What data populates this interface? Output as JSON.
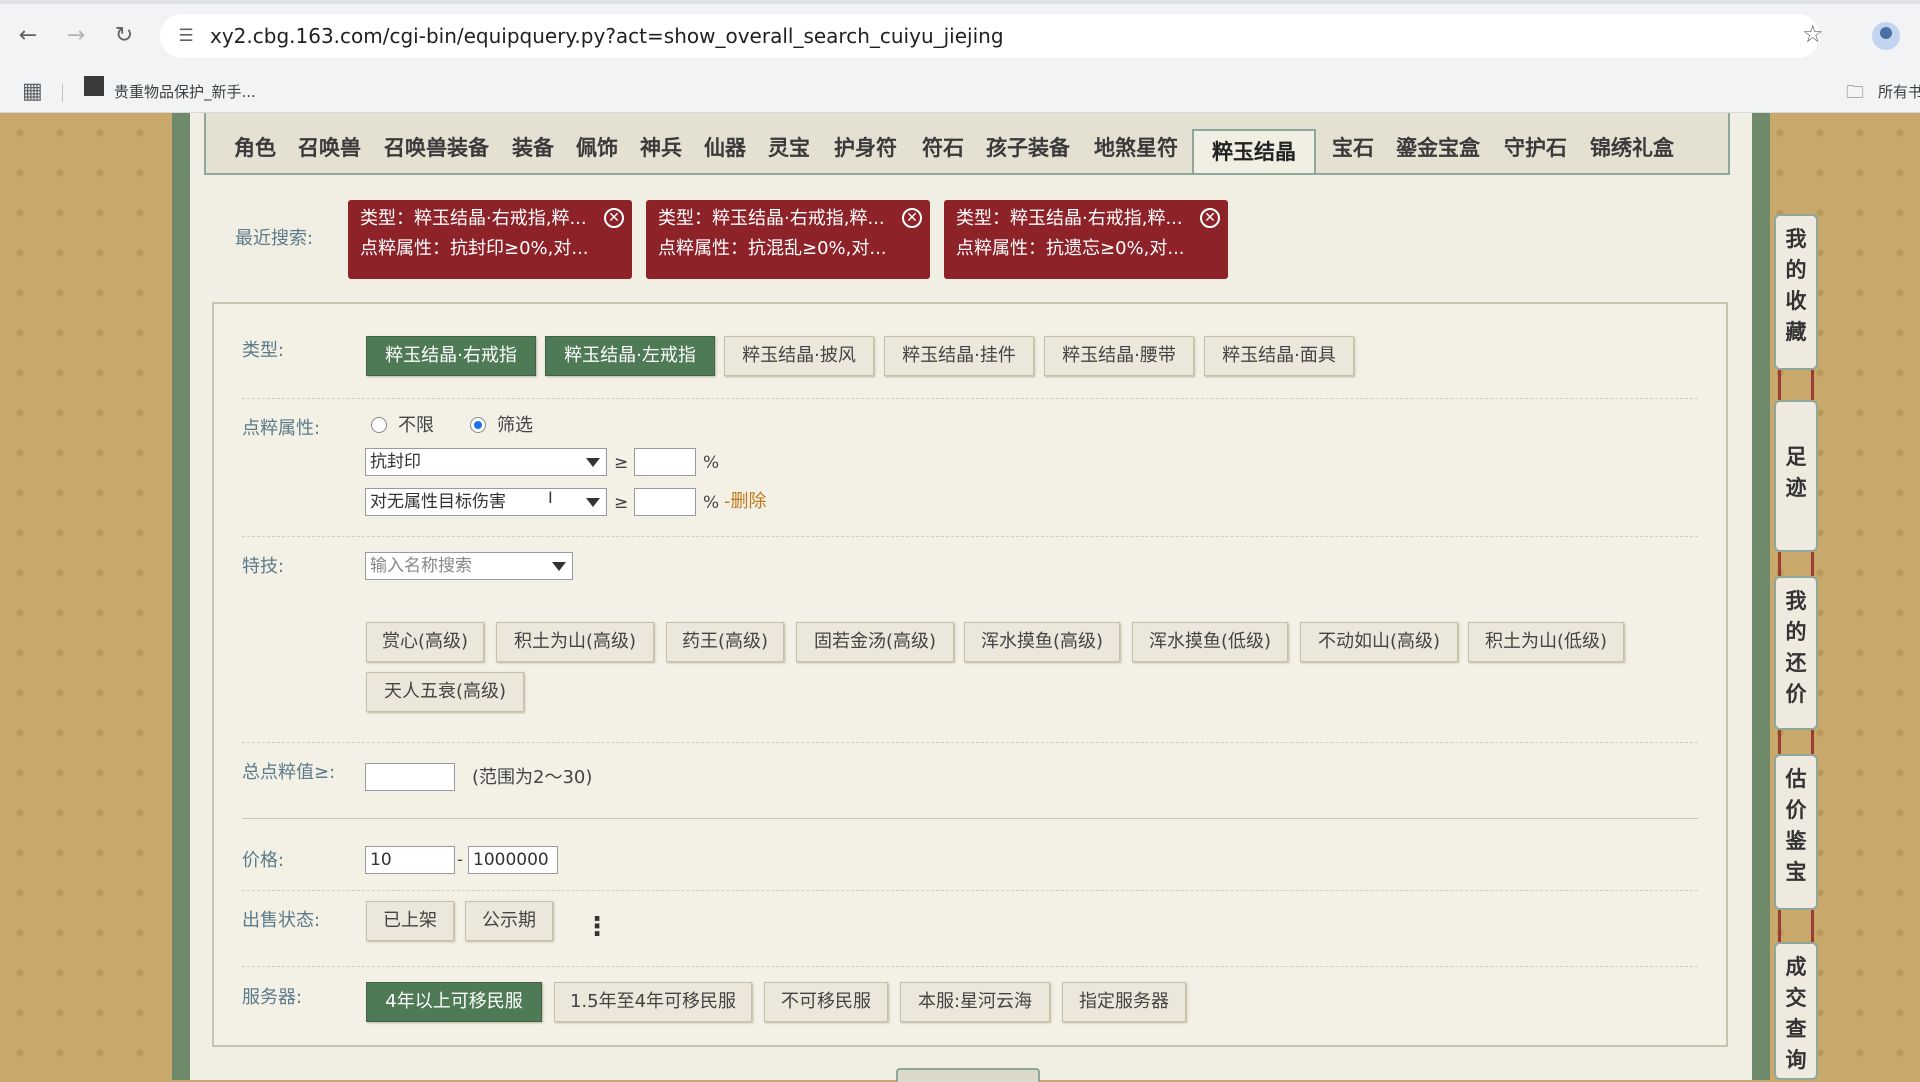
{
  "browser": {
    "url": "xy2.cbg.163.com/cgi-bin/equipquery.py?act=show_overall_search_cuiyu_jiejing",
    "bookmark_label": "贵重物品保护_新手...",
    "bookmarks_folder_label": "所有书"
  },
  "tabs": [
    {
      "label": "角色"
    },
    {
      "label": "召唤兽"
    },
    {
      "label": "召唤兽装备"
    },
    {
      "label": "装备"
    },
    {
      "label": "佩饰"
    },
    {
      "label": "神兵"
    },
    {
      "label": "仙器"
    },
    {
      "label": "灵宝"
    },
    {
      "label": "护身符"
    },
    {
      "label": "符石"
    },
    {
      "label": "孩子装备"
    },
    {
      "label": "地煞星符"
    },
    {
      "label": "粹玉结晶",
      "active": true
    },
    {
      "label": "宝石"
    },
    {
      "label": "鎏金宝盒"
    },
    {
      "label": "守护石"
    },
    {
      "label": "锦绣礼盒"
    }
  ],
  "recent": {
    "label": "最近搜索:",
    "cards": [
      {
        "line1": "类型：粹玉结晶·右戒指,粹...",
        "line2": "点粹属性：抗封印≥0%,对..."
      },
      {
        "line1": "类型：粹玉结晶·右戒指,粹...",
        "line2": "点粹属性：抗混乱≥0%,对..."
      },
      {
        "line1": "类型：粹玉结晶·右戒指,粹...",
        "line2": "点粹属性：抗遗忘≥0%,对..."
      }
    ]
  },
  "filters": {
    "type": {
      "label": "类型:",
      "options": [
        {
          "label": "粹玉结晶·右戒指",
          "selected": true
        },
        {
          "label": "粹玉结晶·左戒指",
          "selected": true
        },
        {
          "label": "粹玉结晶·披风",
          "selected": false
        },
        {
          "label": "粹玉结晶·挂件",
          "selected": false
        },
        {
          "label": "粹玉结晶·腰带",
          "selected": false
        },
        {
          "label": "粹玉结晶·面具",
          "selected": false
        }
      ]
    },
    "attr": {
      "label": "点粹属性:",
      "radio_any": "不限",
      "radio_filter": "筛选",
      "selected_radio": "筛选",
      "rows": [
        {
          "select": "抗封印",
          "ge": "≥",
          "value": "",
          "unit": "%"
        },
        {
          "select": "对无属性目标伤害",
          "ge": "≥",
          "value": "",
          "unit": "%",
          "delete": "-删除"
        }
      ]
    },
    "skill": {
      "label": "特技:",
      "search_placeholder": "输入名称搜索",
      "options": [
        {
          "label": "赏心(高级)"
        },
        {
          "label": "积土为山(高级)"
        },
        {
          "label": "药王(高级)"
        },
        {
          "label": "固若金汤(高级)"
        },
        {
          "label": "浑水摸鱼(高级)"
        },
        {
          "label": "浑水摸鱼(低级)"
        },
        {
          "label": "不动如山(高级)"
        },
        {
          "label": "积土为山(低级)"
        },
        {
          "label": "天人五衰(高级)"
        }
      ]
    },
    "total": {
      "label": "总点粹值≥:",
      "value": "",
      "range_hint": "(范围为2～30)"
    },
    "price": {
      "label": "价格:",
      "min": "10",
      "dash": "-",
      "max": "1000000"
    },
    "sale_status": {
      "label": "出售状态:",
      "options": [
        {
          "label": "已上架"
        },
        {
          "label": "公示期"
        }
      ]
    },
    "server": {
      "label": "服务器:",
      "options": [
        {
          "label": "4年以上可移民服",
          "selected": true
        },
        {
          "label": "1.5年至4年可移民服",
          "selected": false
        },
        {
          "label": "不可移民服",
          "selected": false
        },
        {
          "label": "本服:星河云海",
          "selected": false
        },
        {
          "label": "指定服务器",
          "selected": false
        }
      ]
    }
  },
  "side_nav": [
    {
      "label": "我的收藏"
    },
    {
      "label": "足迹"
    },
    {
      "label": "我的还价"
    },
    {
      "label": "估价鉴宝"
    },
    {
      "label": "成交查询"
    }
  ],
  "colors": {
    "selected_button": "#4e7a55",
    "recent_card": "#8e2229",
    "label_text": "#5c7b8a",
    "delete_link": "#c07a1e"
  }
}
